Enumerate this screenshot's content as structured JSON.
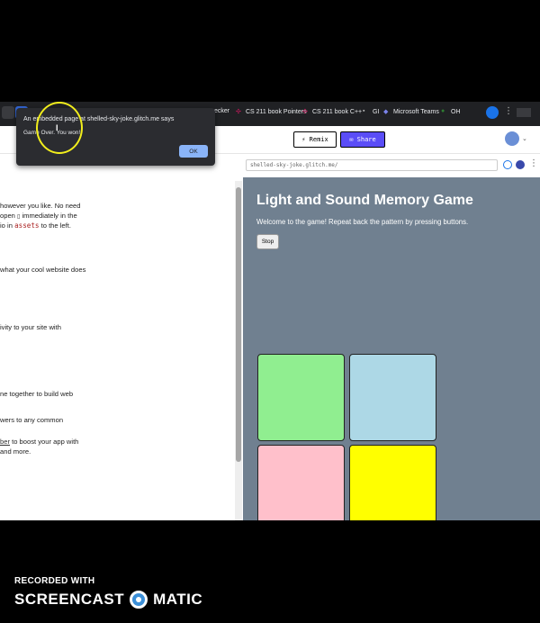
{
  "bookmarks": [
    {
      "label": "ecker"
    },
    {
      "label": "CS 211 book Pointers"
    },
    {
      "label": "CS 211 book C++"
    },
    {
      "label": "GI"
    },
    {
      "label": "Microsoft Teams"
    },
    {
      "label": "OH"
    }
  ],
  "glitch": {
    "remix_label": "⚡ Remix",
    "share_label": "✉ Share"
  },
  "preview": {
    "url": "shelled-sky-joke.glitch.me/"
  },
  "editor": {
    "lines": [
      "however you like. No need",
      "open",
      "immediately in the",
      "io in",
      "assets",
      "to the left.",
      "what your cool website does",
      "ivity to your site with",
      "ne together to build web",
      "wers to any common",
      "ber",
      "to boost your app with",
      "and more."
    ]
  },
  "game": {
    "title": "Light and Sound Memory Game",
    "description": "Welcome to the game! Repeat back the pattern by pressing buttons.",
    "stop_label": "Stop",
    "buttons": [
      {
        "color": "#90ee90"
      },
      {
        "color": "#add8e6"
      },
      {
        "color": "#ffc0cb"
      },
      {
        "color": "#ffff00"
      }
    ]
  },
  "dialog": {
    "title": "An embedded page at shelled-sky-joke.glitch.me says",
    "message": "Game Over. You won!",
    "ok_label": "OK"
  },
  "watermark": {
    "recorded": "RECORDED WITH",
    "brand_left": "SCREENCAST",
    "brand_right": "MATIC"
  }
}
